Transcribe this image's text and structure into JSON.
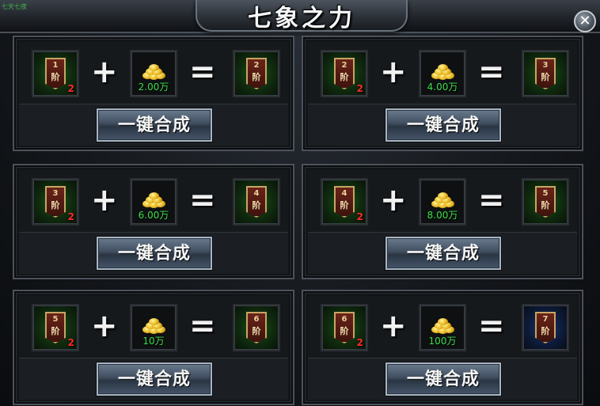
{
  "window": {
    "title": "七象之力",
    "hint": "七天七夜",
    "close_label": "✕"
  },
  "common": {
    "plus": "+",
    "equals": "=",
    "merge_label": "一键合成",
    "tier_char": "阶",
    "input_qty": "2"
  },
  "recipes": [
    {
      "input_tier": "1",
      "cost": "2.00万",
      "output_tier": "2",
      "output_color": "green"
    },
    {
      "input_tier": "2",
      "cost": "4.00万",
      "output_tier": "3",
      "output_color": "green"
    },
    {
      "input_tier": "3",
      "cost": "6.00万",
      "output_tier": "4",
      "output_color": "green"
    },
    {
      "input_tier": "4",
      "cost": "8.00万",
      "output_tier": "5",
      "output_color": "green"
    },
    {
      "input_tier": "5",
      "cost": "10万",
      "output_tier": "6",
      "output_color": "green"
    },
    {
      "input_tier": "6",
      "cost": "100万",
      "output_tier": "7",
      "output_color": "blue"
    }
  ],
  "colors": {
    "green_glow": "#1d5a1b",
    "blue_glow": "#1b3c7a",
    "cost_text": "#3ee04a",
    "qty_text": "#ff2a2a"
  }
}
